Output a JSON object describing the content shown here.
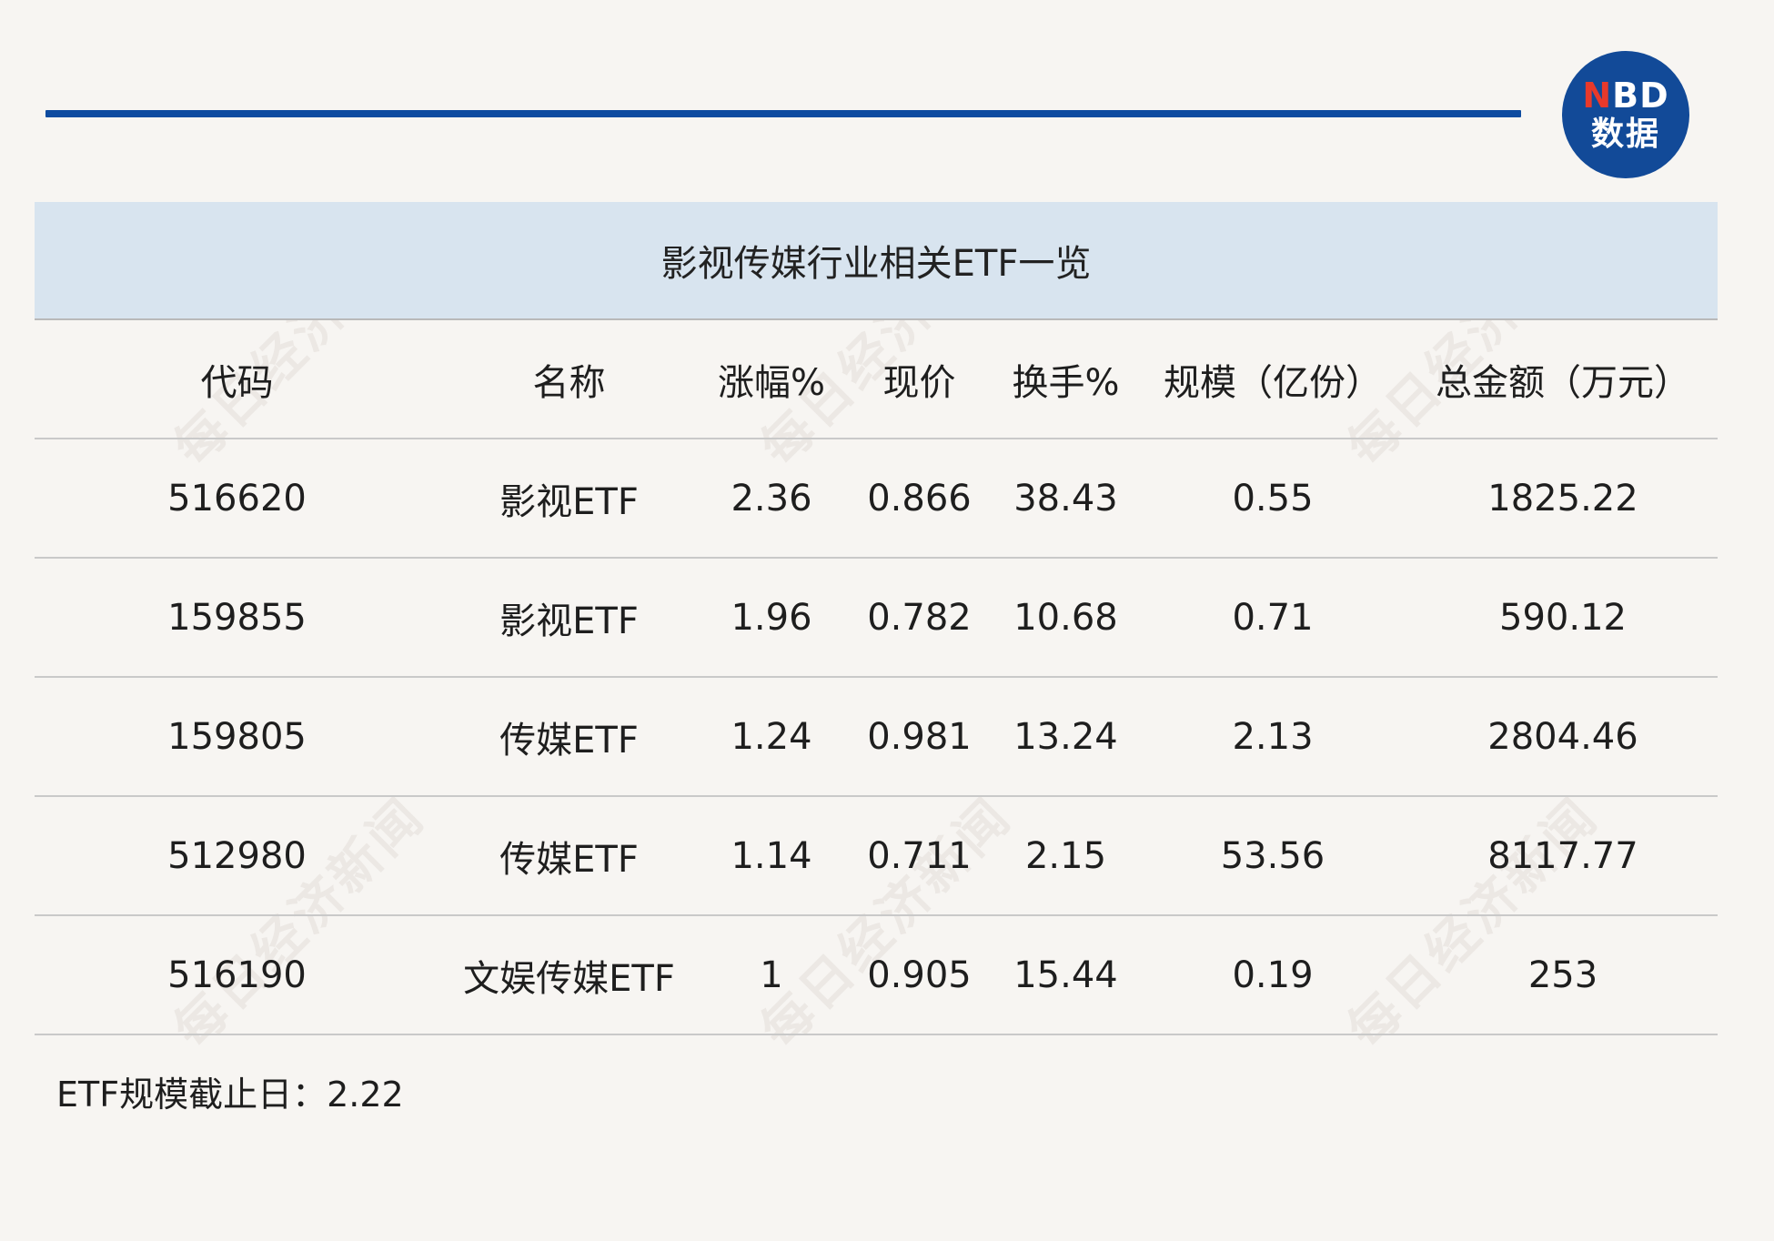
{
  "brand": {
    "logo_top": "NBD",
    "logo_bottom": "数据"
  },
  "watermark": "每日经济新闻",
  "title": "影视传媒行业相关ETF一览",
  "columns": [
    "代码",
    "名称",
    "涨幅%",
    "现价",
    "换手%",
    "规模（亿份）",
    "总金额（万元）"
  ],
  "rows": [
    [
      "516620",
      "影视ETF",
      "2.36",
      "0.866",
      "38.43",
      "0.55",
      "1825.22"
    ],
    [
      "159855",
      "影视ETF",
      "1.96",
      "0.782",
      "10.68",
      "0.71",
      "590.12"
    ],
    [
      "159805",
      "传媒ETF",
      "1.24",
      "0.981",
      "13.24",
      "2.13",
      "2804.46"
    ],
    [
      "512980",
      "传媒ETF",
      "1.14",
      "0.711",
      "2.15",
      "53.56",
      "8117.77"
    ],
    [
      "516190",
      "文娱传媒ETF",
      "1",
      "0.905",
      "15.44",
      "0.19",
      "253"
    ]
  ],
  "footer_note": "ETF规模截止日：2.22",
  "colors": {
    "accent": "#0d4ba0",
    "header_band": "#d8e4ef",
    "logo_bg": "#124a98",
    "logo_n": "#e8392b"
  }
}
